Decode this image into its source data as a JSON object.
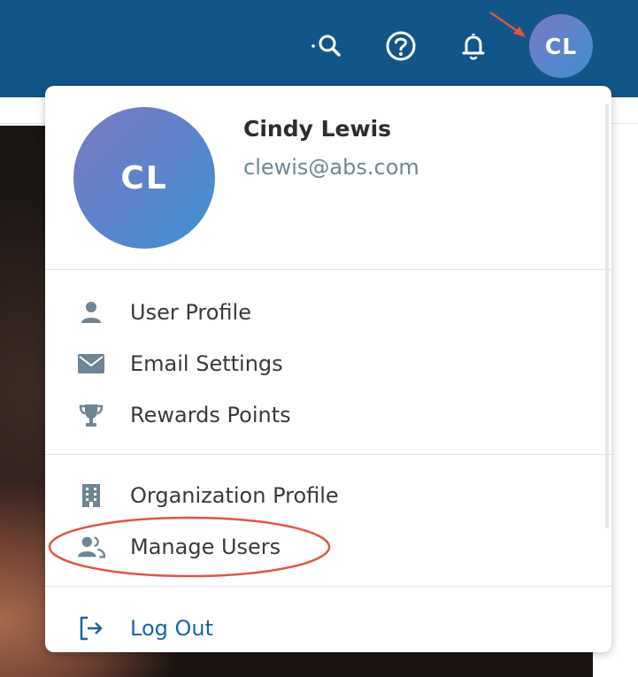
{
  "header": {
    "search_icon": "search-icon",
    "help_icon": "help-circle-icon",
    "notifications_icon": "bell-icon",
    "avatar_initials": "CL"
  },
  "profile": {
    "initials": "CL",
    "name": "Cindy Lewis",
    "email": "clewis@abs.com"
  },
  "menu": {
    "personal": [
      {
        "label": "User Profile",
        "icon": "user-icon"
      },
      {
        "label": "Email Settings",
        "icon": "envelope-icon"
      },
      {
        "label": "Rewards Points",
        "icon": "trophy-icon"
      }
    ],
    "organization": [
      {
        "label": "Organization Profile",
        "icon": "building-icon"
      },
      {
        "label": "Manage Users",
        "icon": "users-icon"
      }
    ],
    "logout": {
      "label": "Log Out",
      "icon": "logout-icon"
    }
  },
  "colors": {
    "header_bg": "#125689",
    "accent_blue": "#1864a6",
    "annotation_red": "#e2553d",
    "icon_gray": "#6e8594"
  }
}
